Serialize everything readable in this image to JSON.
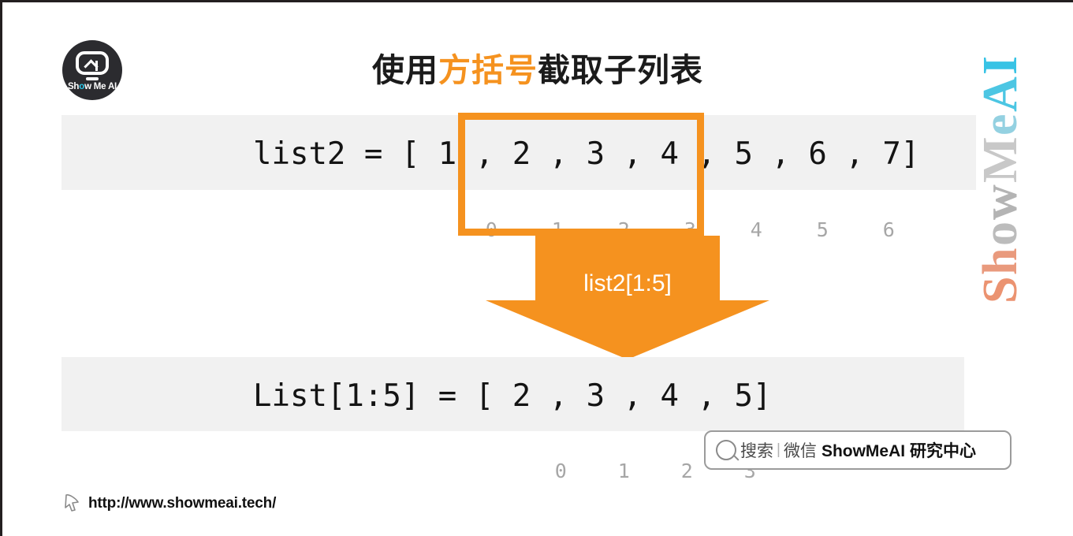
{
  "logo": {
    "name": "showmeai-logo",
    "text_pre": "Sh",
    "text_o": "o",
    "text_post": "w Me AI"
  },
  "title": {
    "part1": "使用",
    "highlight": "方括号",
    "part2": "截取子列表",
    "highlight_color": "#f5921f"
  },
  "code_top": {
    "text": "list2 = [ 1 , 2 , 3 , 4 , 5 , 6 , 7]"
  },
  "code_bottom": {
    "text": "List[1:5] = [ 2 , 3 , 4 , 5]"
  },
  "index_row_top": {
    "values": [
      "0",
      "1",
      "2",
      "3",
      "4",
      "5",
      "6"
    ]
  },
  "index_row_bottom": {
    "values": [
      "0",
      "1",
      "2",
      "3"
    ]
  },
  "selection": {
    "label": "selected-slice",
    "color": "#f5921f"
  },
  "arrow": {
    "label": "list2[1:5]",
    "color": "#f5921f"
  },
  "watermark": {
    "letters": [
      "S",
      "h",
      "o",
      "w",
      "M",
      "e",
      "A",
      "I"
    ]
  },
  "search": {
    "placeholder": "搜索",
    "separator": "|",
    "channel": "微信",
    "brand": "ShowMeAI 研究中心"
  },
  "footer": {
    "url": "http://www.showmeai.tech/"
  }
}
